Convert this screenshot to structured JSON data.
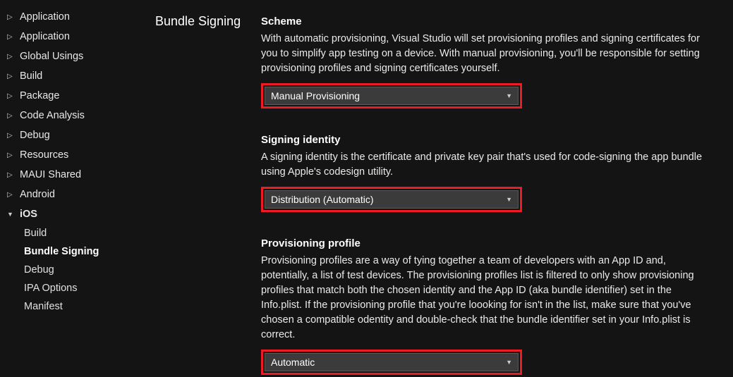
{
  "sidebar": {
    "items": [
      {
        "label": "Application",
        "expanded": false
      },
      {
        "label": "Application",
        "expanded": false
      },
      {
        "label": "Global Usings",
        "expanded": false
      },
      {
        "label": "Build",
        "expanded": false
      },
      {
        "label": "Package",
        "expanded": false
      },
      {
        "label": "Code Analysis",
        "expanded": false
      },
      {
        "label": "Debug",
        "expanded": false
      },
      {
        "label": "Resources",
        "expanded": false
      },
      {
        "label": "MAUI Shared",
        "expanded": false
      },
      {
        "label": "Android",
        "expanded": false
      },
      {
        "label": "iOS",
        "expanded": true,
        "children": [
          {
            "label": "Build",
            "selected": false
          },
          {
            "label": "Bundle Signing",
            "selected": true
          },
          {
            "label": "Debug",
            "selected": false
          },
          {
            "label": "IPA Options",
            "selected": false
          },
          {
            "label": "Manifest",
            "selected": false
          }
        ]
      }
    ]
  },
  "section_title": "Bundle Signing",
  "settings": {
    "scheme": {
      "heading": "Scheme",
      "description": "With automatic provisioning, Visual Studio will set provisioning profiles and signing certificates for you to simplify app testing on a device. With manual provisioning, you'll be responsible for setting provisioning profiles and signing certificates yourself.",
      "value": "Manual Provisioning"
    },
    "signing_identity": {
      "heading": "Signing identity",
      "description": "A signing identity is the certificate and private key pair that's used for code-signing the app bundle using Apple's codesign utility.",
      "value": "Distribution (Automatic)"
    },
    "provisioning_profile": {
      "heading": "Provisioning profile",
      "description": "Provisioning profiles are a way of tying together a team of developers with an App ID and, potentially, a list of test devices. The provisioning profiles list is filtered to only show provisioning profiles that match both the chosen identity and the App ID (aka bundle identifier) set in the Info.plist. If the provisioning profile that you're loooking for isn't in the list, make sure that you've chosen a compatible odentity and double-check that the bundle identifier set in your Info.plist is correct.",
      "value": "Automatic"
    }
  }
}
